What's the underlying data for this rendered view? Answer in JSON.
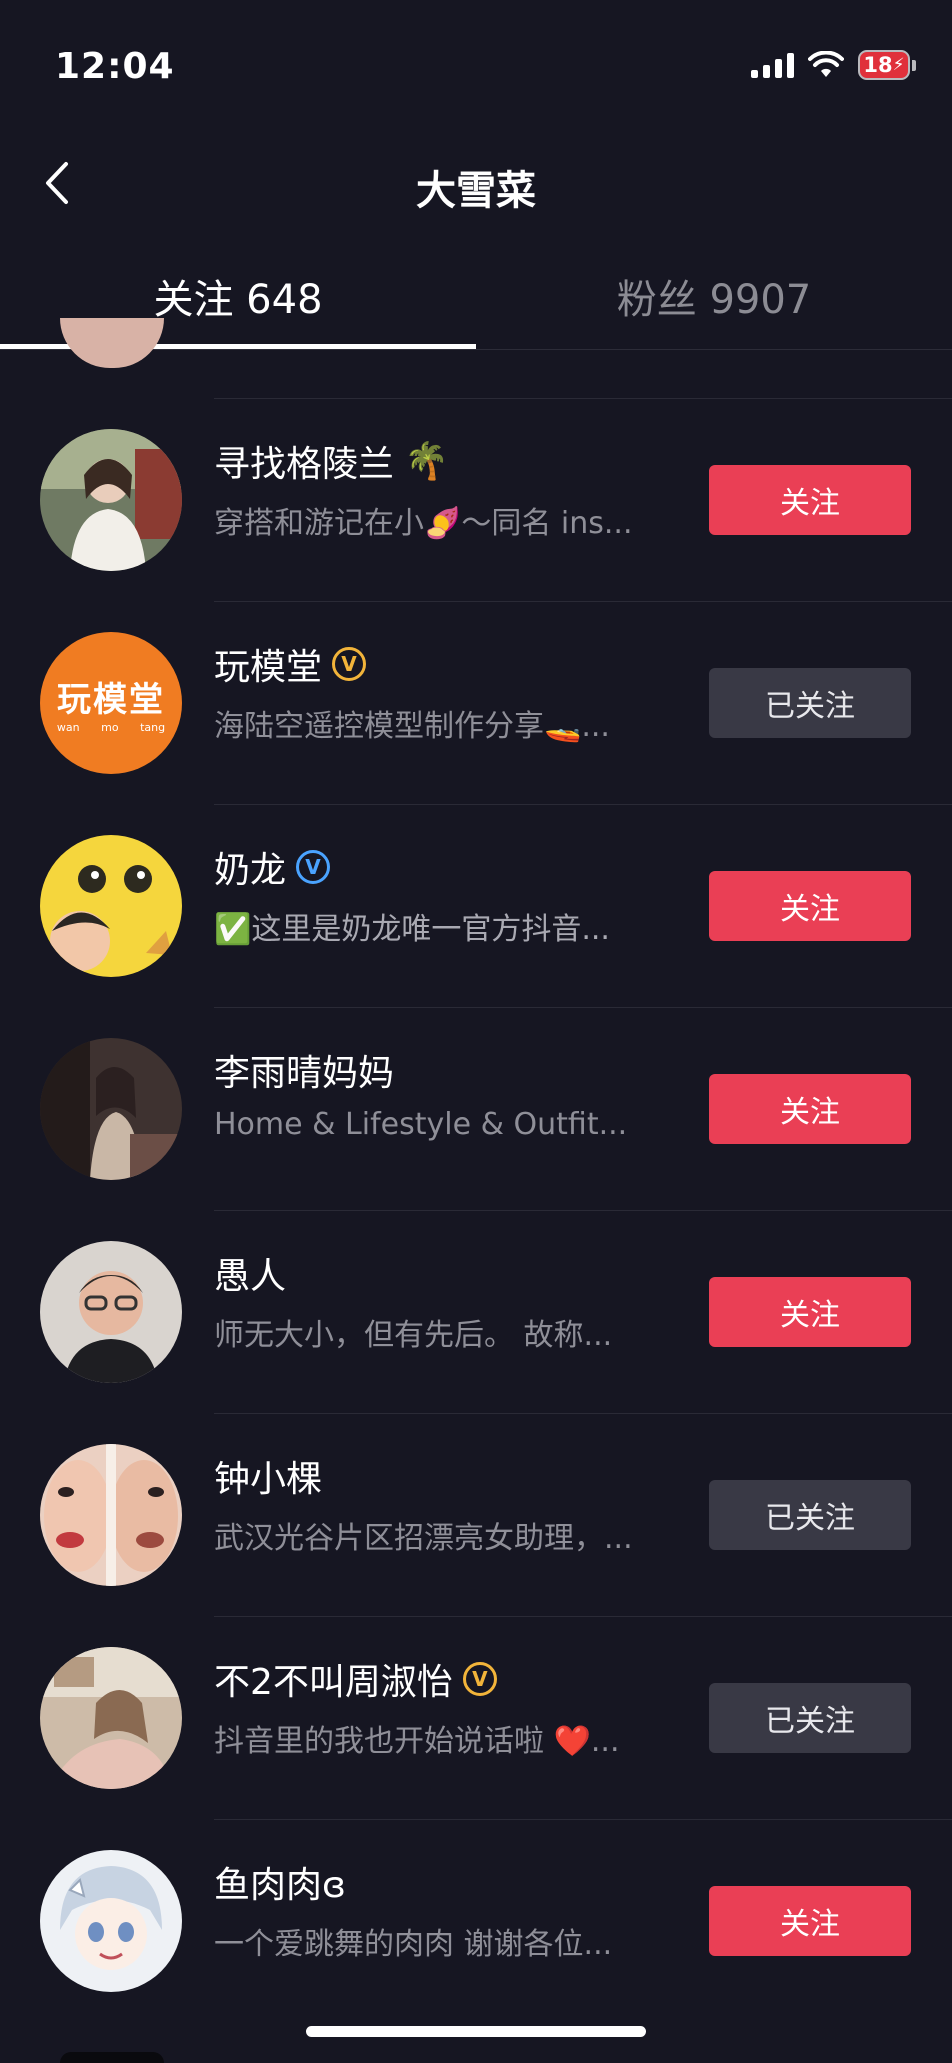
{
  "status_bar": {
    "time": "12:04",
    "battery": "18"
  },
  "header": {
    "title": "大雪菜"
  },
  "tabs": [
    {
      "label": "关注 648",
      "active": true
    },
    {
      "label": "粉丝 9907",
      "active": false
    }
  ],
  "users": [
    {
      "name": "寻找格陵兰",
      "name_emoji": "🌴",
      "verified": "none",
      "description": "穿搭和游记在小🍠～同名 ins...",
      "button": "关注",
      "following": false,
      "avatar_color": "#c9c3b7"
    },
    {
      "name": "玩模堂",
      "name_emoji": "",
      "verified": "gold",
      "description": "海陆空遥控模型制作分享🚤...",
      "button": "已关注",
      "following": true,
      "avatar_color": "#f07c22",
      "avatar_text": "玩模堂",
      "avatar_subtext": "wan mo tang"
    },
    {
      "name": "奶龙",
      "name_emoji": "",
      "verified": "blue",
      "description": "✅这里是奶龙唯一官方抖音...",
      "button": "关注",
      "following": false,
      "avatar_color": "#f5d63d"
    },
    {
      "name": "李雨晴妈妈",
      "name_emoji": "",
      "verified": "none",
      "description": "Home & Lifestyle & Outfit...",
      "button": "关注",
      "following": false,
      "avatar_color": "#5b4a46"
    },
    {
      "name": "愚人",
      "name_emoji": "",
      "verified": "none",
      "description": "师无大小，但有先后。 故称...",
      "button": "关注",
      "following": false,
      "avatar_color": "#cfc9c3"
    },
    {
      "name": "钟小棵",
      "name_emoji": "",
      "verified": "none",
      "description": "武汉光谷片区招漂亮女助理，...",
      "button": "已关注",
      "following": true,
      "avatar_color": "#e6c3b2"
    },
    {
      "name": "不2不叫周淑怡",
      "name_emoji": "",
      "verified": "gold",
      "description": "抖音里的我也开始说话啦 ❤️...",
      "button": "已关注",
      "following": true,
      "avatar_color": "#d8c2b0"
    },
    {
      "name": "鱼肉肉ɞ",
      "name_emoji": "",
      "verified": "none",
      "description": "一个爱跳舞的肉肉 谢谢各位...",
      "button": "关注",
      "following": false,
      "avatar_color": "#e9edf3"
    }
  ],
  "colors": {
    "background": "#161622",
    "follow_button": "#ea3f55",
    "followed_button": "#393945",
    "badge_gold": "#f2b43a",
    "badge_blue": "#4aa3ff"
  }
}
